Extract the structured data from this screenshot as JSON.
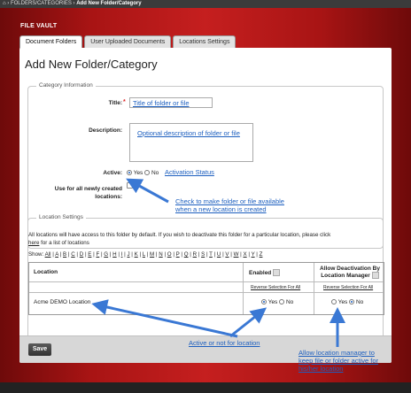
{
  "breadcrumb": {
    "home_icon": "home-icon",
    "separator": "›",
    "parent": "FOLDERS/CATEGORIES",
    "current": "Add New Folder/Category"
  },
  "app": {
    "title": "FILE VAULT"
  },
  "tabs": [
    {
      "label": "Document Folders",
      "active": true
    },
    {
      "label": "User Uploaded Documents",
      "active": false
    },
    {
      "label": "Locations Settings",
      "active": false
    }
  ],
  "page": {
    "title": "Add New Folder/Category"
  },
  "category": {
    "legend": "Category Information",
    "title_label": "Title:",
    "required_mark": "*",
    "title_value": "Title of folder or file",
    "description_label": "Description:",
    "description_value": "Optional description of folder or file",
    "active_label": "Active:",
    "yes_label": "Yes",
    "no_label": "No",
    "active_note": "Activation Status",
    "newloc_label_1": "Use for all newly created",
    "newloc_label_2": "locations:",
    "newloc_note_1": "Check to make folder or file available",
    "newloc_note_2": "when a new location is created"
  },
  "location": {
    "legend": "Location Settings",
    "info_line_1": "All locations will have access to this folder by default. If you wish to deactivate this folder for a particular location, please click",
    "info_here": "here",
    "info_line_2_rest": "for a list of locations",
    "show_label": "Show:",
    "letters": [
      "All",
      "A",
      "B",
      "C",
      "D",
      "E",
      "F",
      "G",
      "H",
      "I",
      "J",
      "K",
      "L",
      "M",
      "N",
      "O",
      "P",
      "Q",
      "R",
      "S",
      "T",
      "U",
      "V",
      "W",
      "X",
      "Y",
      "Z"
    ],
    "col_location": "Location",
    "col_enabled": "Enabled",
    "col_allow_1": "Allow Deactivation By",
    "col_allow_2": "Location Manager",
    "reverse_enabled": "Reverse Selection For All",
    "reverse_allow": "Reverse Selection For All",
    "rows": [
      {
        "name": "Acme DEMO Location",
        "enabled": "Yes",
        "allow": "No"
      }
    ],
    "yes_label": "Yes",
    "no_label": "No"
  },
  "annotations": {
    "active_or_not": "Active or not for location",
    "allow_mgr_1": "Allow location manager to",
    "allow_mgr_2": "keep file or folder active for",
    "allow_mgr_3": "his/her location"
  },
  "footer": {
    "save_label": "Save"
  },
  "colors": {
    "accent": "#c51f1f",
    "annotation": "#1d5fbf"
  }
}
